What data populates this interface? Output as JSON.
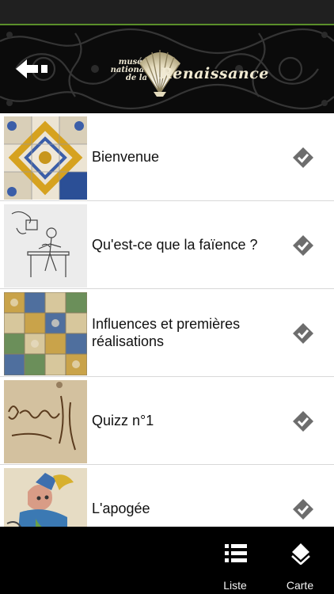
{
  "header": {
    "logo_small": [
      "musée",
      "national",
      "de la"
    ],
    "logo_big": "Renaissance"
  },
  "list": {
    "items": [
      {
        "label": "Bienvenue",
        "thumb": "tiles-blue-yellow-image",
        "checked": true
      },
      {
        "label": "Qu'est-ce que la faïence ?",
        "thumb": "potter-sketch-image",
        "checked": true
      },
      {
        "label": "Influences et premières réalisations",
        "thumb": "tile-wall-image",
        "checked": true
      },
      {
        "label": "Quizz n°1",
        "thumb": "handwriting-manuscript-image",
        "checked": true
      },
      {
        "label": "L'apogée",
        "thumb": "painted-figure-plate-image",
        "checked": true
      }
    ]
  },
  "bottombar": {
    "tabs": [
      {
        "label": "Liste",
        "icon": "list-icon"
      },
      {
        "label": "Carte",
        "icon": "map-layers-icon"
      }
    ]
  },
  "colors": {
    "accent_statusbar": "#5a8f2a",
    "check": "#6d6d6d",
    "header_bg": "#0b0b0b"
  }
}
